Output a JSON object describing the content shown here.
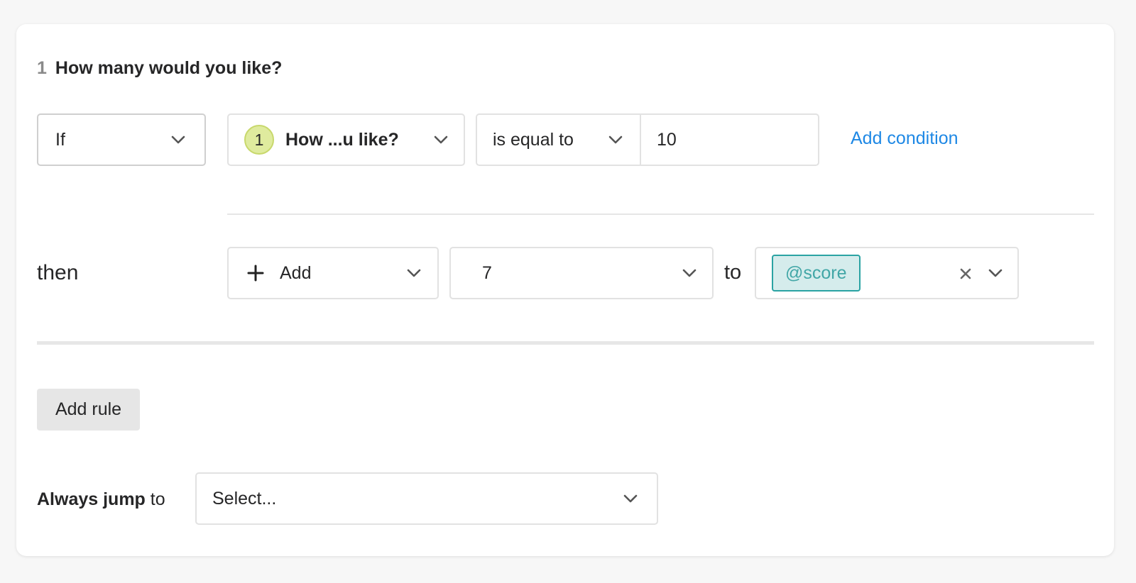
{
  "question": {
    "number": "1",
    "title": "How many would you like?"
  },
  "condition": {
    "if_label": "If",
    "question_badge": "1",
    "question_short": "How ...u like?",
    "operator": "is equal to",
    "value": "10",
    "add_condition": "Add condition"
  },
  "action": {
    "then_label": "then",
    "action": "Add",
    "amount": "7",
    "to_label": "to",
    "variable": "@score"
  },
  "add_rule": "Add rule",
  "jump": {
    "label_bold": "Always jump",
    "label_rest": " to",
    "placeholder": "Select..."
  },
  "colors": {
    "link": "#1e88e5",
    "badge_bg": "#dfeb9e",
    "tag_bg": "#d5ecec",
    "tag_border": "#2aa3a3",
    "tag_text": "#41a6a6"
  },
  "icons": {
    "dropdown": "chevron-down-icon",
    "plus": "plus-icon",
    "clear": "close-icon"
  }
}
